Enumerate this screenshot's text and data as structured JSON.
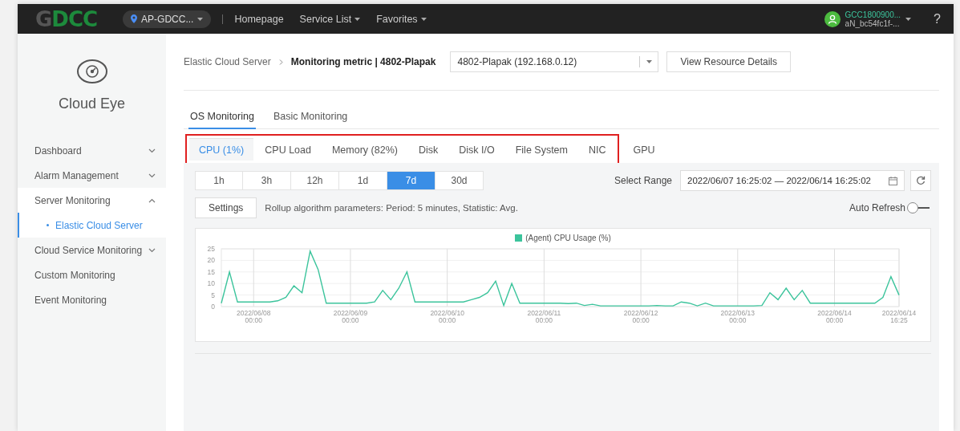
{
  "top_bar": {
    "logo": "GDCC",
    "region": "AP-GDCC...",
    "nav": [
      {
        "label": "Homepage",
        "dropdown": false
      },
      {
        "label": "Service List",
        "dropdown": true
      },
      {
        "label": "Favorites",
        "dropdown": true
      }
    ],
    "user": {
      "name": "GCC1800900...",
      "account": "aN_bc54fc1f-..."
    },
    "help": "?"
  },
  "sidebar": {
    "title": "Cloud Eye",
    "items": [
      {
        "label": "Dashboard",
        "kind": "group",
        "expanded": false,
        "selected": false
      },
      {
        "label": "Alarm Management",
        "kind": "group",
        "expanded": false,
        "selected": false
      },
      {
        "label": "Server Monitoring",
        "kind": "group",
        "expanded": true,
        "selected": false,
        "children": [
          {
            "label": "Elastic Cloud Server",
            "kind": "link",
            "selected": true
          }
        ]
      },
      {
        "label": "Cloud Service Monitoring",
        "kind": "group",
        "expanded": false,
        "selected": false
      },
      {
        "label": "Custom Monitoring",
        "kind": "link",
        "selected": false
      },
      {
        "label": "Event Monitoring",
        "kind": "link",
        "selected": false
      }
    ]
  },
  "breadcrumb": {
    "parent": "Elastic Cloud Server",
    "current": "Monitoring metric | 4802-Plapak"
  },
  "instance_select": {
    "value": "4802-Plapak (192.168.0.12)"
  },
  "details_button": "View Resource Details",
  "tabs": [
    {
      "label": "OS Monitoring",
      "selected": true
    },
    {
      "label": "Basic Monitoring",
      "selected": false
    }
  ],
  "metric_tab_groups": [
    {
      "kind": "framed",
      "tabs": [
        {
          "label": "CPU (1%)",
          "selected": true
        },
        {
          "label": "CPU Load",
          "selected": false
        },
        {
          "label": "Memory (82%)",
          "selected": false
        },
        {
          "label": "Disk",
          "selected": false
        },
        {
          "label": "Disk I/O",
          "selected": false
        },
        {
          "label": "File System",
          "selected": false
        },
        {
          "label": "NIC",
          "selected": false
        }
      ]
    },
    {
      "kind": "plain",
      "tabs": [
        {
          "label": "GPU",
          "selected": false
        }
      ]
    }
  ],
  "periods": [
    {
      "label": "1h",
      "selected": false
    },
    {
      "label": "3h",
      "selected": false
    },
    {
      "label": "12h",
      "selected": false
    },
    {
      "label": "1d",
      "selected": false
    },
    {
      "label": "7d",
      "selected": true
    },
    {
      "label": "30d",
      "selected": false
    }
  ],
  "range": {
    "label": "Select Range",
    "value": "2022/06/07 16:25:02 — 2022/06/14 16:25:02"
  },
  "settings_button": "Settings",
  "rollup_text": "Rollup algorithm parameters: Period: 5 minutes, Statistic: Avg.",
  "auto_refresh": {
    "label": "Auto Refresh",
    "on": false
  },
  "chart": {
    "chart_data": {
      "type": "line",
      "grid": true,
      "ylim": [
        0,
        25
      ],
      "yticks": [
        0,
        5,
        10,
        15,
        20,
        25
      ],
      "categories": [
        null,
        null,
        null,
        null,
        "2022/06/08 00:00",
        null,
        null,
        null,
        null,
        null,
        null,
        null,
        null,
        null,
        null,
        null,
        "2022/06/09 00:00",
        null,
        null,
        null,
        null,
        null,
        null,
        null,
        null,
        null,
        null,
        null,
        "2022/06/10 00:00",
        null,
        null,
        null,
        null,
        null,
        null,
        null,
        null,
        null,
        null,
        null,
        "2022/06/11 00:00",
        null,
        null,
        null,
        null,
        null,
        null,
        null,
        null,
        null,
        null,
        null,
        "2022/06/12 00:00",
        null,
        null,
        null,
        null,
        null,
        null,
        null,
        null,
        null,
        null,
        null,
        "2022/06/13 00:00",
        null,
        null,
        null,
        null,
        null,
        null,
        null,
        null,
        null,
        null,
        null,
        "2022/06/14 00:00",
        null,
        null,
        null,
        null,
        null,
        null,
        null,
        "2022/06/14 16:25"
      ],
      "series": [
        {
          "name": "(Agent) CPU Usage (%)",
          "color": "#3cc49c",
          "values": [
            1.5,
            15,
            2,
            2,
            2,
            2,
            2,
            2.5,
            4,
            9,
            6,
            24,
            16,
            1.5,
            1.5,
            1.5,
            1.5,
            1.5,
            1.5,
            2,
            7,
            3,
            8,
            15,
            2,
            2,
            2,
            2,
            2,
            2,
            2,
            3,
            4,
            6,
            11,
            0.5,
            10,
            1.5,
            1.5,
            1.5,
            1.5,
            1.5,
            1.5,
            1.3,
            1.5,
            0.5,
            1,
            0.3,
            0.3,
            0.3,
            0.3,
            0.3,
            0.3,
            0.3,
            0.5,
            0.3,
            0.3,
            2,
            1.5,
            0.3,
            1.5,
            0.3,
            0.3,
            0.3,
            0.3,
            0.3,
            0.3,
            0.5,
            6,
            3,
            8,
            3,
            7,
            1.5,
            1.5,
            1.5,
            1.5,
            1.5,
            1.5,
            1.5,
            1.5,
            1.5,
            4,
            13,
            5
          ]
        }
      ]
    }
  }
}
